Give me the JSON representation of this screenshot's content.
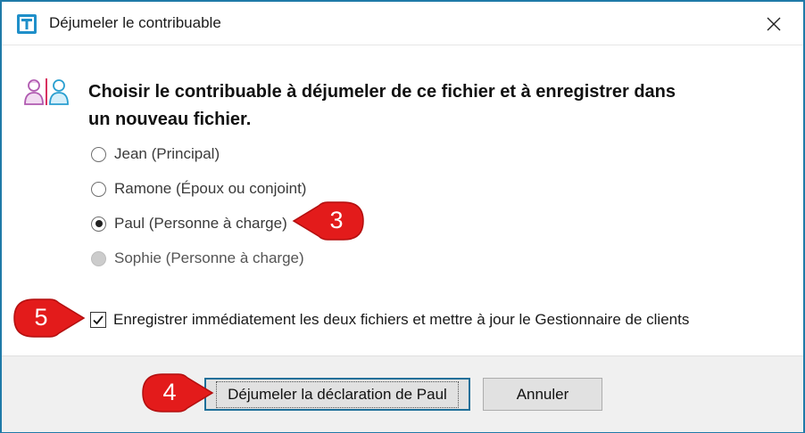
{
  "window": {
    "title": "Déjumeler le contribuable",
    "close_icon": "close-icon",
    "app_icon": "taxcycle-app-icon",
    "accent_color": "#1f7aa8"
  },
  "main": {
    "heading_line1": "Choisir le contribuable à déjumeler de ce fichier et à enregistrer dans",
    "heading_line2": "un nouveau fichier.",
    "people_icon": "couple-people-icon",
    "radio_options": [
      {
        "label": "Jean (Principal)",
        "checked": false,
        "disabled": false
      },
      {
        "label": "Ramone (Époux ou conjoint)",
        "checked": false,
        "disabled": false
      },
      {
        "label": "Paul (Personne à charge)",
        "checked": true,
        "disabled": false
      },
      {
        "label": "Sophie (Personne à charge)",
        "checked": false,
        "disabled": true
      }
    ],
    "save_checkbox": {
      "label": "Enregistrer immédiatement les deux fichiers et mettre à jour le Gestionnaire de clients",
      "checked": true
    }
  },
  "footer": {
    "primary_button_label": "Déjumeler la déclaration de Paul",
    "cancel_button_label": "Annuler"
  },
  "callouts": [
    {
      "number": "3",
      "color": "#e31b1b"
    },
    {
      "number": "5",
      "color": "#e31b1b"
    },
    {
      "number": "4",
      "color": "#e31b1b"
    }
  ]
}
